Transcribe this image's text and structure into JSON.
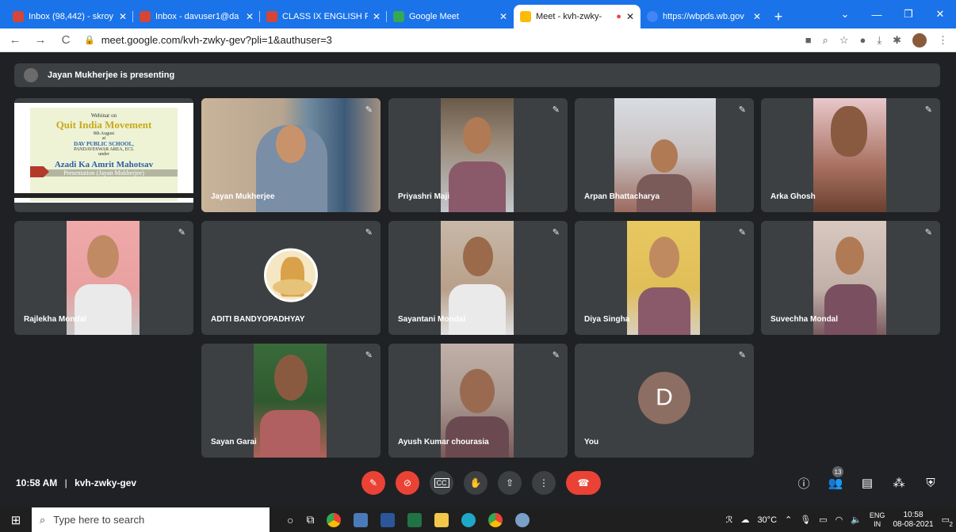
{
  "browser": {
    "tabs": [
      {
        "label": "Inbox (98,442) - skroy",
        "icon_color": "#d44638",
        "active": false
      },
      {
        "label": "Inbox - davuser1@da",
        "icon_color": "#d44638",
        "active": false
      },
      {
        "label": "CLASS IX ENGLISH PE",
        "icon_color": "#d44638",
        "active": false
      },
      {
        "label": "Google Meet",
        "icon_color": "#34a853",
        "active": false
      },
      {
        "label": "Meet - kvh-zwky-",
        "icon_color": "#fbbc04",
        "active": true
      },
      {
        "label": "https://wbpds.wb.gov",
        "icon_color": "#4285f4",
        "active": false
      }
    ],
    "url": "meet.google.com/kvh-zwky-gev?pli=1&authuser=3"
  },
  "presenting_banner": "Jayan Mukherjee is presenting",
  "slide": {
    "line1": "Webinar on",
    "line2": "Quit India Movement",
    "line3": "8th August",
    "line4": "at",
    "line5": "DAV PUBLIC SCHOOL,",
    "line6": "PANDAVESWAR AREA, ECL",
    "line7": "under",
    "line8": "Azadi Ka Amrit Mahotsav",
    "caption": "Presentation (Jayan Mukherjee)"
  },
  "participants": [
    {
      "name": "Jayan Mukherjee"
    },
    {
      "name": "Priyashri Maji"
    },
    {
      "name": "Arpan Bhattacharya"
    },
    {
      "name": "Arka Ghosh"
    },
    {
      "name": "Rajlekha Mondal"
    },
    {
      "name": "ADITI BANDYOPADHYAY"
    },
    {
      "name": "Sayantani Mondal"
    },
    {
      "name": "Diya Singha"
    },
    {
      "name": "Suvechha Mondal"
    },
    {
      "name": "Sayan Garai"
    },
    {
      "name": "Ayush Kumar chourasia"
    },
    {
      "name": "You",
      "initial": "D"
    }
  ],
  "meeting": {
    "time": "10:58 AM",
    "separator": "|",
    "code": "kvh-zwky-gev",
    "participant_count": "13"
  },
  "taskbar": {
    "search_placeholder": "Type here to search",
    "weather": "30°C",
    "lang1": "ENG",
    "lang2": "IN",
    "time": "10:58",
    "date": "08-08-2021",
    "notif_count": "2"
  }
}
